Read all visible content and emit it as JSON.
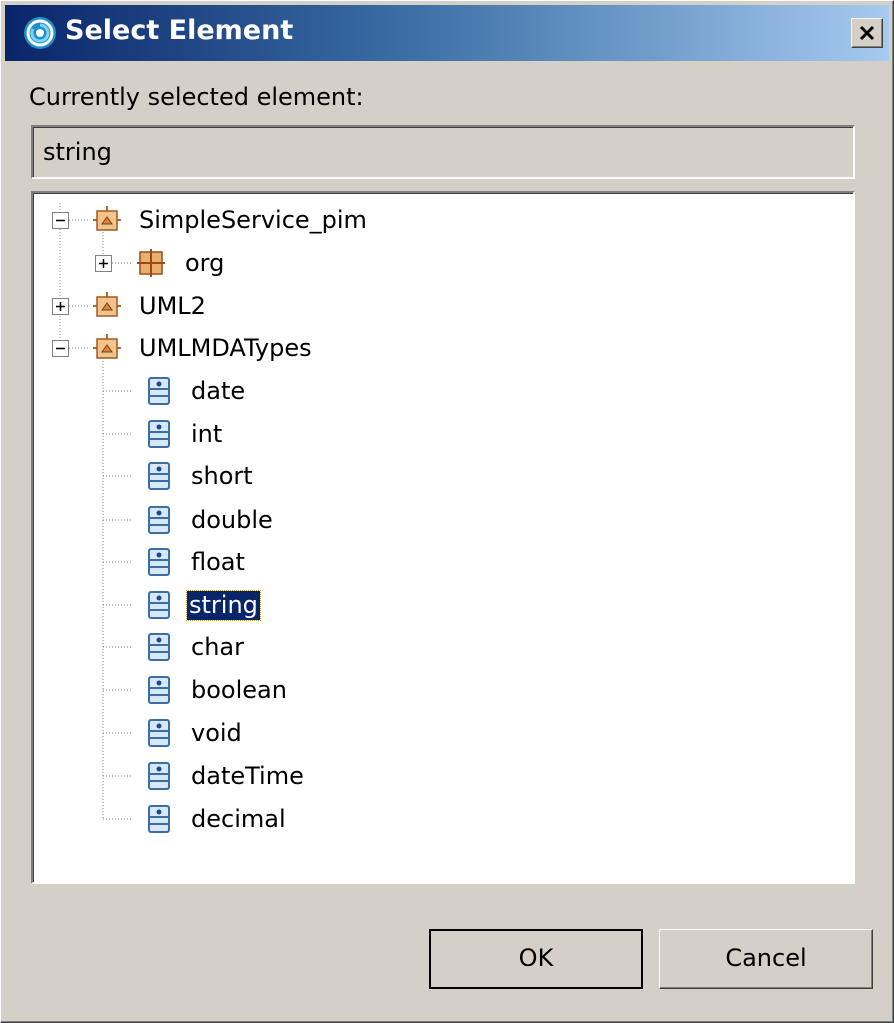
{
  "window": {
    "title": "Select Element",
    "close_icon": "close-icon",
    "app_icon": "eclipse-spiral-icon"
  },
  "current": {
    "label": "Currently selected element:",
    "value": "string"
  },
  "tree": {
    "nodes": [
      {
        "label": "SimpleService_pim",
        "icon": "model-package-icon",
        "expander": "minus"
      },
      {
        "label": "org",
        "icon": "package-icon",
        "expander": "plus"
      },
      {
        "label": "UML2",
        "icon": "model-package-icon",
        "expander": "plus"
      },
      {
        "label": "UMLMDATypes",
        "icon": "model-package-icon",
        "expander": "minus"
      },
      {
        "label": "date",
        "icon": "primitive-type-icon"
      },
      {
        "label": "int",
        "icon": "primitive-type-icon"
      },
      {
        "label": "short",
        "icon": "primitive-type-icon"
      },
      {
        "label": "double",
        "icon": "primitive-type-icon"
      },
      {
        "label": "float",
        "icon": "primitive-type-icon"
      },
      {
        "label": "string",
        "icon": "primitive-type-icon",
        "selected": true
      },
      {
        "label": "char",
        "icon": "primitive-type-icon"
      },
      {
        "label": "boolean",
        "icon": "primitive-type-icon"
      },
      {
        "label": "void",
        "icon": "primitive-type-icon"
      },
      {
        "label": "dateTime",
        "icon": "primitive-type-icon"
      },
      {
        "label": "decimal",
        "icon": "primitive-type-icon"
      }
    ]
  },
  "buttons": {
    "ok": "OK",
    "cancel": "Cancel"
  },
  "colors": {
    "title_gradient_start": "#0a246a",
    "title_gradient_end": "#a6caf0",
    "dialog_bg": "#d4d0c8",
    "selection_bg": "#0a246a"
  }
}
